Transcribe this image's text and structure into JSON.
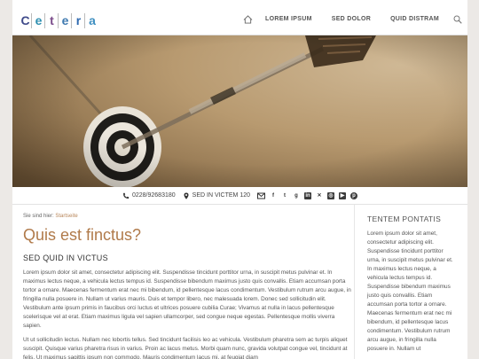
{
  "brand": {
    "logo_letters": [
      "C",
      "e",
      "t",
      "e",
      "r",
      "a"
    ],
    "logo_colors": [
      "#3f4a8a",
      "#2f8fb0",
      "#7a4a8a",
      "#3f7ab0",
      "#2f6ab0",
      "#3f8fc0"
    ]
  },
  "nav": {
    "items": [
      "LOREM IPSUM",
      "SED DOLOR",
      "QUID DISTRAM"
    ]
  },
  "contact": {
    "phone": "0228/92683180",
    "address": "SED IN VICTEM 120",
    "social": [
      "mail",
      "f",
      "t",
      "g",
      "in",
      "x",
      "ig",
      "yt",
      "p"
    ]
  },
  "breadcrumb": {
    "prefix": "Sie sind hier:",
    "link": "Startseite"
  },
  "main": {
    "title": "Quis est finctus?",
    "subtitle": "SED QUID IN VICTUS",
    "paragraphs": [
      "Lorem ipsum dolor sit amet, consectetur adipiscing elit. Suspendisse tincidunt porttitor urna, in suscipit metus pulvinar et. In maximus lectus neque, a vehicula lectus tempus id. Suspendisse bibendum maximus justo quis convallis. Etiam accumsan porta tortor a ornare. Maecenas fermentum erat nec mi bibendum, id pellentesque lacus condimentum. Vestibulum rutrum arcu augue, in fringilla nulla posuere in. Nullam ut varius mauris. Duis et tempor libero, nec malesuada lorem. Donec sed sollicitudin elit. Vestibulum ante ipsum primis in faucibus orci luctus et ultrices posuere cubilia Curae; Vivamus at nulla in lacus pellentesque scelerisque vel at erat. Etiam maximus ligula vel sapien ullamcorper, sed congue neque egestas. Pellentesque mollis viverra sapien.",
      "Ut ut sollicitudin lectus. Nullam nec lobortis tellus. Sed tincidunt facilisis leo ac vehicula. Vestibulum pharetra sem ac turpis aliquet suscipit. Quisque varius pharetra risus in varius. Proin ac lacus metus. Morbi quam nunc, gravida volutpat congue vel, tincidunt at felis. Ut maximus sagittis ipsum non commodo. Mauris condimentum lacus mi, at feugiat diam"
    ]
  },
  "sidebar": {
    "title": "TENTEM PONTATIS",
    "text": "Lorem ipsum dolor sit amet, consectetur adipiscing elit. Suspendisse tincidunt porttitor urna, in suscipit metus pulvinar et. In maximus lectus neque, a vehicula lectus tempus id. Suspendisse bibendum maximus justo quis convallis. Etiam accumsan porta tortor a ornare. Maecenas fermentum erat nec mi bibendum, id pellentesque lacus condimentum. Vestibulum rutrum arcu augue, in fringilla nulla posuere in. Nullam ut"
  },
  "colors": {
    "accent": "#b07a4a",
    "link": "#b8865a",
    "page_bg": "#ece9e6"
  }
}
